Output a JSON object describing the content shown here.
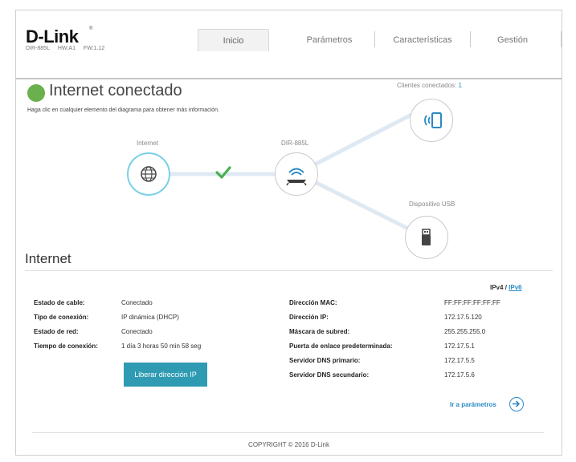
{
  "header": {
    "logo": "D-Link",
    "model": "DIR-885L",
    "hw": "HW:A1",
    "fw": "FW:1.12",
    "tabs": [
      "Inicio",
      "Parámetros",
      "Características",
      "Gestión"
    ]
  },
  "status": {
    "title": "Internet conectado",
    "hint": "Haga clic en cualquier elemento del diagrama para obtener más información.",
    "color": "#6ab04c"
  },
  "diagram": {
    "internet_label": "Internet",
    "router_label": "DIR-885L",
    "clients_label": "Clientes conectados:",
    "clients_count": "1",
    "usb_label": "Dispositivo USB",
    "icons": {
      "internet": "globe-icon",
      "router": "router-icon",
      "clients": "wireless-device-icon",
      "usb": "usb-drive-icon",
      "link_ok": "checkmark-icon"
    }
  },
  "internet": {
    "title": "Internet",
    "ip_version": {
      "v4": "IPv4",
      "sep": "/",
      "v6": "IPv6"
    },
    "left": [
      {
        "label": "Estado de cable:",
        "value": "Conectado"
      },
      {
        "label": "Tipo de conexión:",
        "value": "IP dinámica (DHCP)"
      },
      {
        "label": "Estado de red:",
        "value": "Conectado"
      },
      {
        "label": "Tiempo de conexión:",
        "value": "1 día 3 horas 50 min 58 seg"
      }
    ],
    "right": [
      {
        "label": "Dirección MAC:",
        "value": "FF:FF:FF:FF:FF:FF"
      },
      {
        "label": "Dirección IP:",
        "value": "172.17.5.120"
      },
      {
        "label": "Máscara de subred:",
        "value": "255.255.255.0"
      },
      {
        "label": "Puerta de enlace predeterminada:",
        "value": "172.17.5.1"
      },
      {
        "label": "Servidor DNS primario:",
        "value": "172.17.5.5"
      },
      {
        "label": "Servidor DNS secundario:",
        "value": "172.17.5.6"
      }
    ],
    "release_button": "Liberar dirección IP",
    "goto_link": "Ir a parámetros"
  },
  "footer": {
    "copyright": "COPYRIGHT © 2016 D-Link"
  },
  "colors": {
    "accent": "#2a8ac4",
    "button": "#2f9bb3",
    "link_line": "#dfe9f3",
    "internet_ring": "#7ad0e6",
    "check": "#4caf50"
  }
}
